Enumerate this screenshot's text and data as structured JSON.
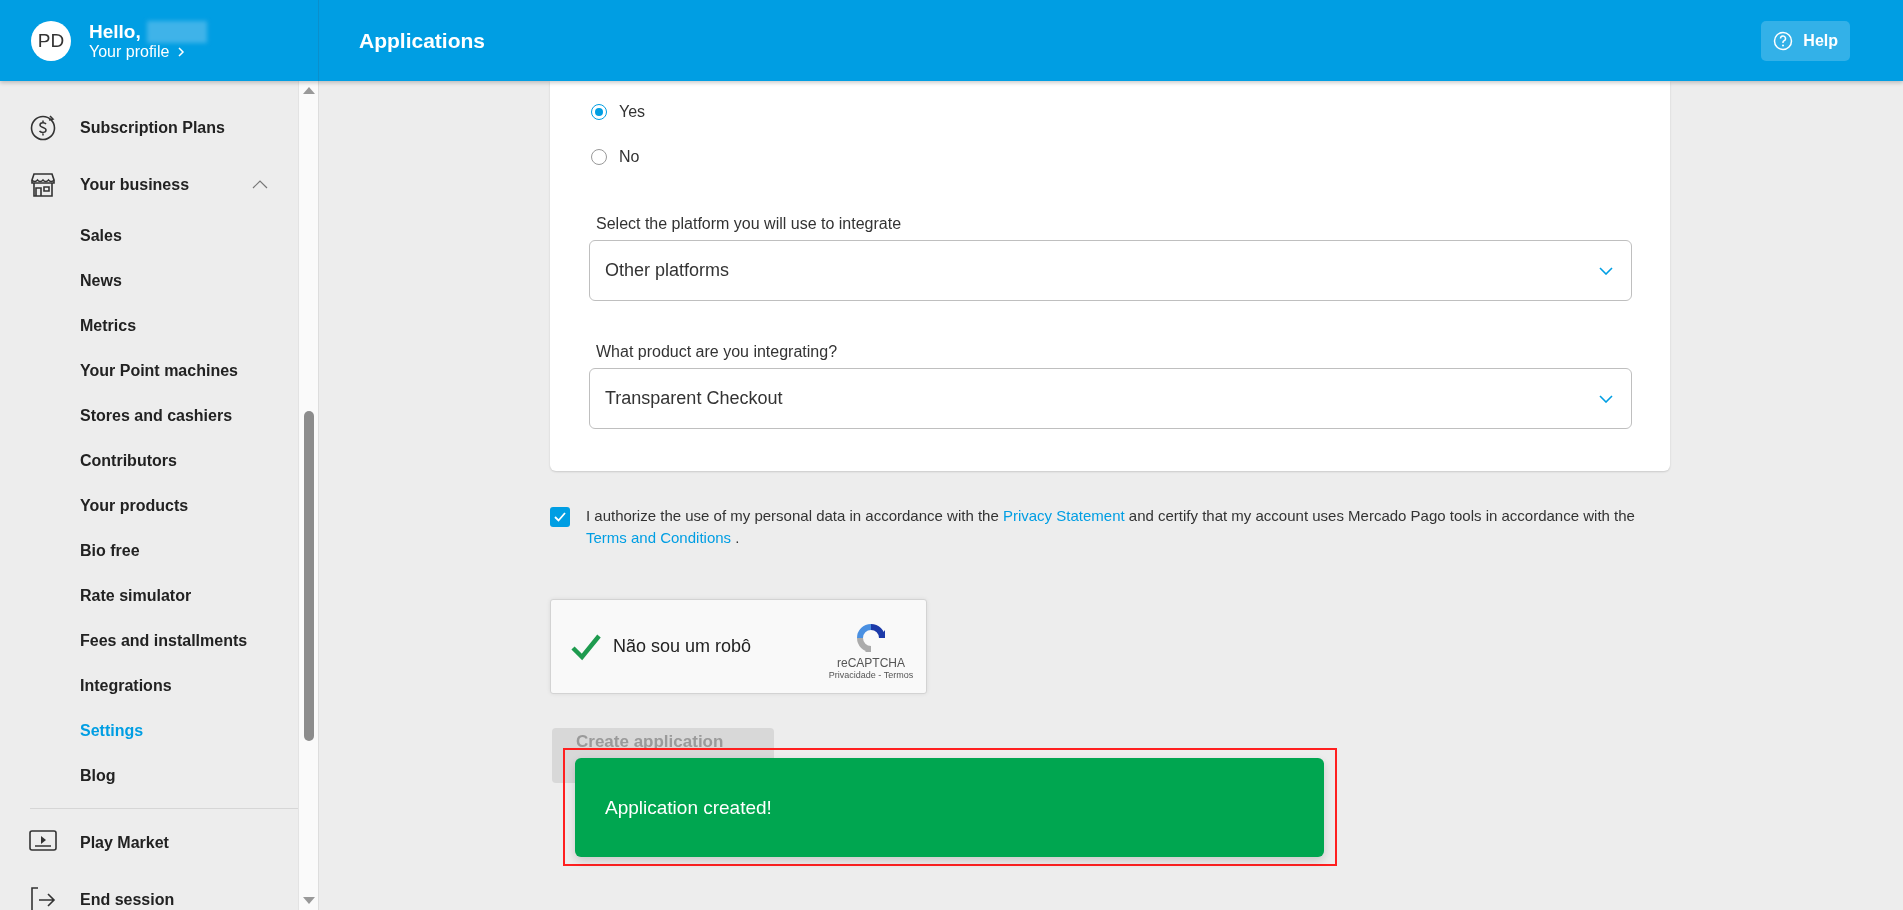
{
  "header": {
    "avatar": "PD",
    "greeting": "Hello,",
    "profile_link": "Your profile",
    "title": "Applications",
    "help": "Help"
  },
  "sidebar": {
    "items": [
      {
        "label": "Subscription Plans"
      },
      {
        "label": "Your business",
        "expanded": true,
        "children": [
          {
            "label": "Sales",
            "selected": false
          },
          {
            "label": "News",
            "selected": false
          },
          {
            "label": "Metrics",
            "selected": false
          },
          {
            "label": "Your Point machines",
            "selected": false
          },
          {
            "label": "Stores and cashiers",
            "selected": false
          },
          {
            "label": "Contributors",
            "selected": false
          },
          {
            "label": "Your products",
            "selected": false
          },
          {
            "label": "Bio free",
            "selected": false
          },
          {
            "label": "Rate simulator",
            "selected": false
          },
          {
            "label": "Fees and installments",
            "selected": false
          },
          {
            "label": "Integrations",
            "selected": false
          },
          {
            "label": "Settings",
            "selected": true
          },
          {
            "label": "Blog",
            "selected": false
          }
        ]
      }
    ],
    "footer_items": [
      {
        "label": "Play Market"
      },
      {
        "label": "End session"
      }
    ]
  },
  "form": {
    "radio_options": [
      {
        "label": "Yes",
        "selected": true
      },
      {
        "label": "No",
        "selected": false
      }
    ],
    "selects": [
      {
        "label": "Select the platform you will use to integrate",
        "value": "Other platforms"
      },
      {
        "label": "What product are you integrating?",
        "value": "Transparent Checkout"
      }
    ]
  },
  "consent": {
    "checked": true,
    "parts": [
      {
        "kind": "text",
        "text": "I authorize the use of my personal data in accordance with the "
      },
      {
        "kind": "link",
        "text": "Privacy Statement"
      },
      {
        "kind": "text",
        "text": "  and certify that my account uses Mercado Pago tools in accordance with the "
      },
      {
        "kind": "link",
        "text": "Terms and Conditions"
      },
      {
        "kind": "text",
        "text": " ."
      }
    ]
  },
  "captcha": {
    "checked": true,
    "label": "Não sou um robô",
    "brand": "reCAPTCHA",
    "links": "Privacidade - Termos"
  },
  "submit": {
    "label": "Create application",
    "disabled": true
  },
  "toast": {
    "message": "Application created!",
    "highlighted": true
  }
}
